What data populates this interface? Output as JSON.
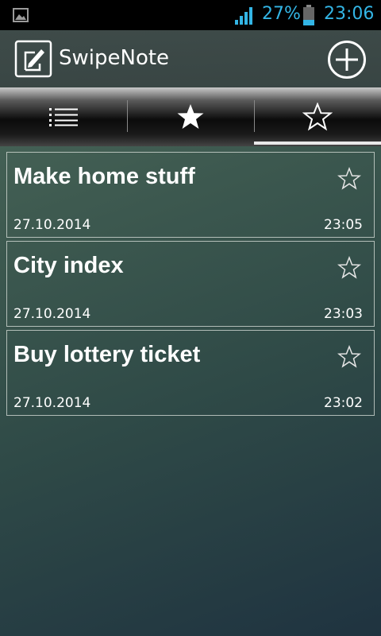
{
  "status_bar": {
    "battery_percent": "27%",
    "time": "23:06",
    "accent_color": "#33b5e5",
    "icons": [
      "image-icon",
      "signal-icon",
      "battery-icon"
    ]
  },
  "app_bar": {
    "title": "SwipeNote",
    "icons": [
      "note-pen-icon",
      "add-circle-icon"
    ]
  },
  "tabs": [
    {
      "icon": "list-icon",
      "selected": false
    },
    {
      "icon": "star-filled-icon",
      "selected": false
    },
    {
      "icon": "star-outline-icon",
      "selected": true
    }
  ],
  "notes": [
    {
      "title": "Make home stuff",
      "date": "27.10.2014",
      "time": "23:05",
      "starred": false
    },
    {
      "title": "City index",
      "date": "27.10.2014",
      "time": "23:03",
      "starred": false
    },
    {
      "title": "Buy lottery ticket",
      "date": "27.10.2014",
      "time": "23:02",
      "starred": false
    }
  ]
}
